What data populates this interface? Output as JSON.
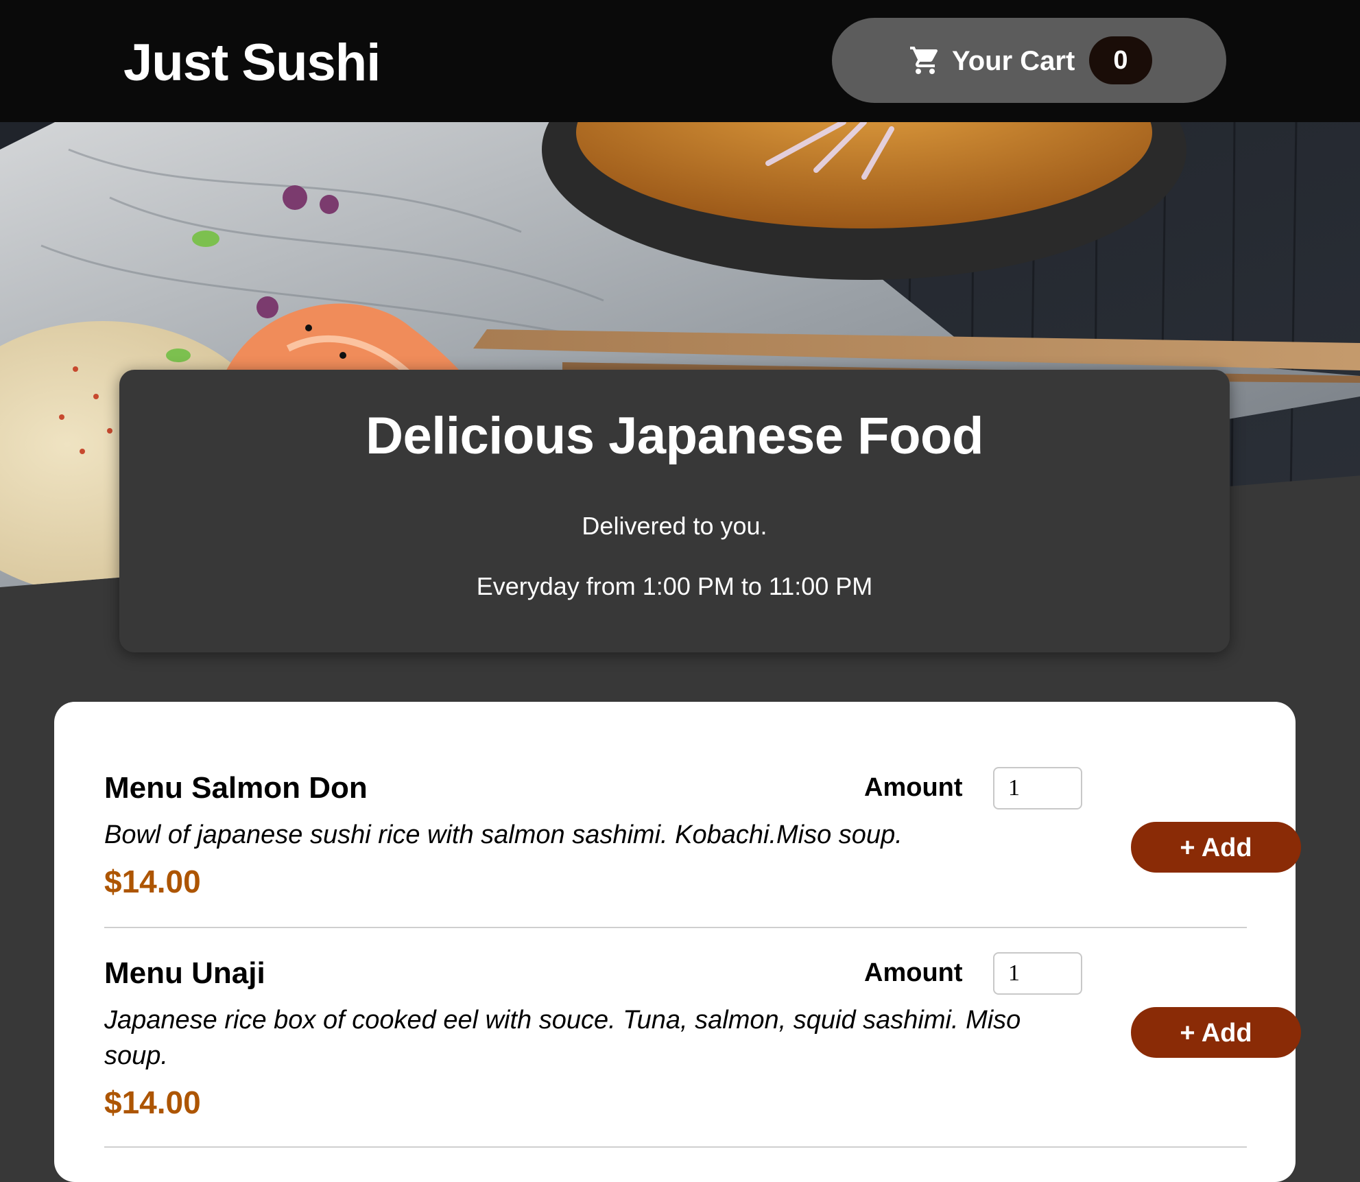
{
  "header": {
    "logo": "Just Sushi",
    "cart_label": "Your Cart",
    "cart_count": "0"
  },
  "summary": {
    "title": "Delicious Japanese Food",
    "line1": "Delivered to you.",
    "line2": "Everyday from 1:00 PM to 11:00 PM"
  },
  "meals": [
    {
      "name": "Menu Salmon Don",
      "description": "Bowl of japanese sushi rice with salmon sashimi. Kobachi.Miso soup.",
      "price": "$14.00",
      "amount_label": "Amount",
      "amount_value": "1",
      "add_label": "+ Add"
    },
    {
      "name": "Menu Unaji",
      "description": "Japanese rice box of cooked eel with souce. Tuna, salmon, squid sashimi. Miso soup.",
      "price": "$14.00",
      "amount_label": "Amount",
      "amount_value": "1",
      "add_label": "+ Add"
    }
  ],
  "colors": {
    "header_bg": "#0a0a0a",
    "cart_button_bg": "#5c5c5c",
    "page_bg": "#383838",
    "price": "#ad5502",
    "add_button": "#8a2b06"
  },
  "icons": {
    "cart": "shopping-cart-icon"
  }
}
